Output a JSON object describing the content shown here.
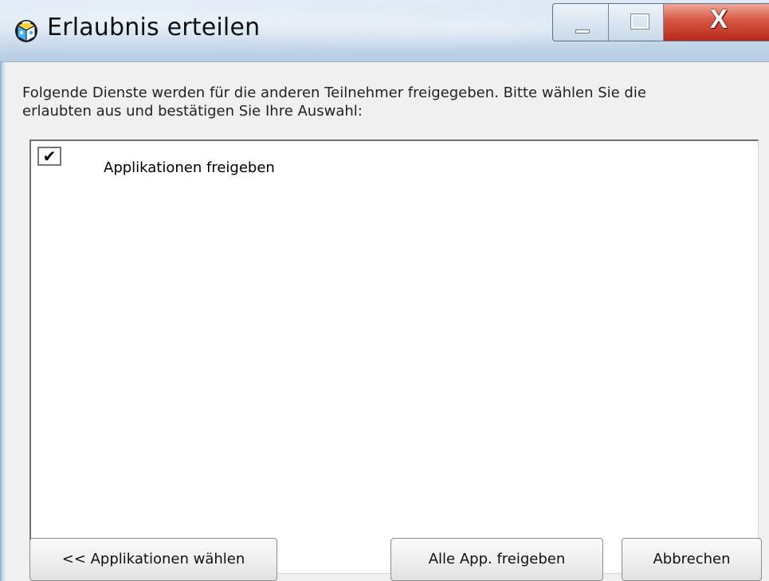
{
  "window": {
    "title": "Erlaubnis erteilen",
    "icon": "puzzle-cube-icon",
    "controls": {
      "minimize_icon": "minimize-icon",
      "maximize_icon": "maximize-icon",
      "close_label": "X"
    }
  },
  "content": {
    "prompt_line_1": "Folgende Dienste werden für die anderen Teilnehmer freigegeben. Bitte wählen Sie die",
    "prompt_line_2": "erlaubten aus und bestätigen Sie Ihre Auswahl:",
    "services": [
      {
        "checked_mark": "✔",
        "label": "Applikationen freigeben"
      }
    ]
  },
  "buttons": {
    "back": "<< Applikationen wählen",
    "share_all": "Alle App. freigeben",
    "cancel": "Abbrechen"
  },
  "colors": {
    "titlebar": "#cbdced",
    "dialog_background": "#f0f0f0",
    "close_button": "#d65a45"
  }
}
